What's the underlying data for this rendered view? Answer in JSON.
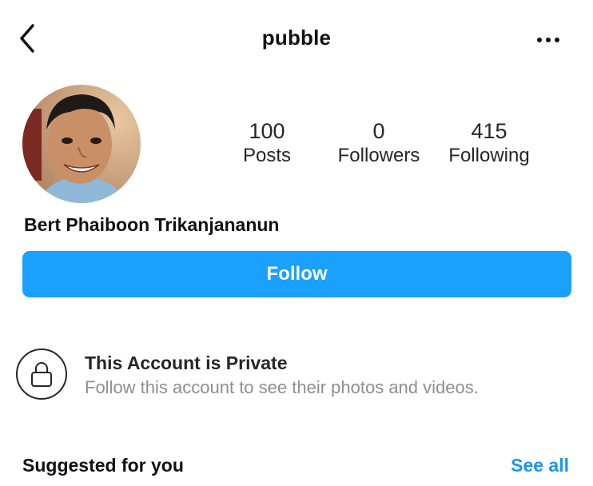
{
  "header": {
    "username": "pubble",
    "back_icon": "chevron-left-icon",
    "more_icon": "more-horizontal-icon"
  },
  "profile": {
    "full_name": "Bert Phaiboon Trikanjananun",
    "stats": [
      {
        "value": "100",
        "label": "Posts"
      },
      {
        "value": "0",
        "label": "Followers"
      },
      {
        "value": "415",
        "label": "Following"
      }
    ],
    "follow_label": "Follow"
  },
  "private_notice": {
    "icon": "lock-icon",
    "title": "This Account is Private",
    "subtitle": "Follow this account to see their photos and videos."
  },
  "suggested": {
    "title": "Suggested for you",
    "see_all_label": "See all"
  },
  "colors": {
    "accent": "#1aa0ff",
    "link": "#1a95f0",
    "muted_text": "#8e8e8e"
  }
}
